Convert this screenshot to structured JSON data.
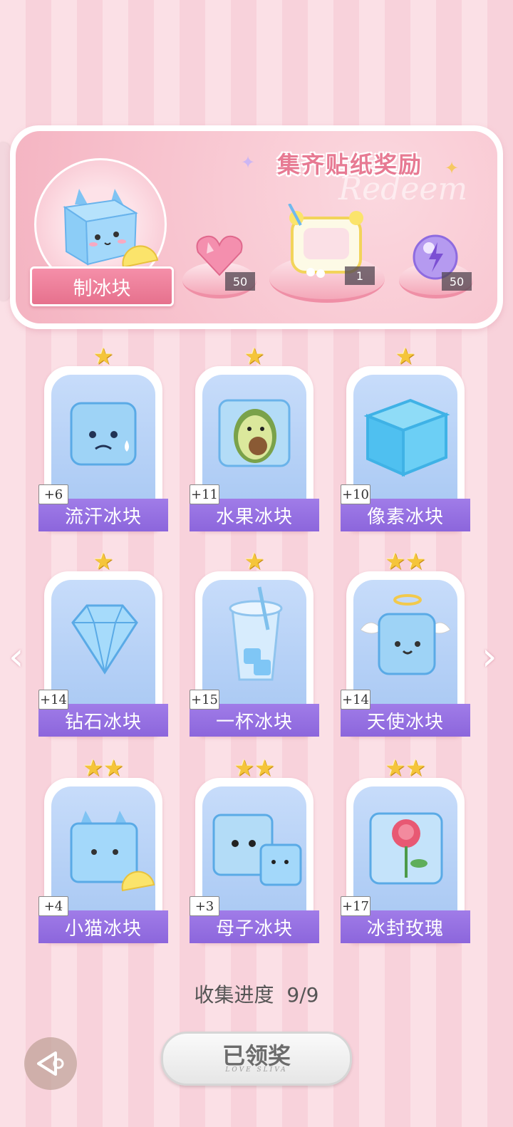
{
  "banner": {
    "title": "集齐贴纸奖励",
    "watermark": "Redeem",
    "main_item_label": "制冰块",
    "rewards": [
      {
        "icon": "pink-heart-gem-icon",
        "count": "50"
      },
      {
        "icon": "lemonade-photo-frame-icon",
        "count": "1"
      },
      {
        "icon": "purple-energy-orb-icon",
        "count": "50"
      }
    ]
  },
  "cards": [
    {
      "name": "流汗冰块",
      "plus": "+6",
      "stars": "★",
      "icon": "sweating-ice-cube-icon"
    },
    {
      "name": "水果冰块",
      "plus": "+11",
      "stars": "★",
      "icon": "avocado-ice-cube-icon"
    },
    {
      "name": "像素冰块",
      "plus": "+10",
      "stars": "★",
      "icon": "pixel-ice-cube-icon"
    },
    {
      "name": "钻石冰块",
      "plus": "+14",
      "stars": "★",
      "icon": "diamond-ice-icon"
    },
    {
      "name": "一杯冰块",
      "plus": "+15",
      "stars": "★",
      "icon": "cup-of-ice-icon"
    },
    {
      "name": "天使冰块",
      "plus": "+14",
      "stars": "★★",
      "icon": "angel-ice-cube-icon"
    },
    {
      "name": "小猫冰块",
      "plus": "+4",
      "stars": "★★",
      "icon": "cat-ice-cube-icon"
    },
    {
      "name": "母子冰块",
      "plus": "+3",
      "stars": "★★",
      "icon": "mother-child-ice-cubes-icon"
    },
    {
      "name": "冰封玫瑰",
      "plus": "+17",
      "stars": "★★",
      "icon": "frozen-rose-icon"
    }
  ],
  "progress": {
    "label": "收集进度",
    "value": "9/9"
  },
  "claim_button": {
    "label": "已领奖",
    "sub": "LOVE SLIVA"
  },
  "nav": {
    "left": "‹",
    "right": "›"
  },
  "colors": {
    "accent_pink": "#e77a93",
    "card_name_purple": "#9a76e4",
    "star_gold": "#f5c53a"
  }
}
